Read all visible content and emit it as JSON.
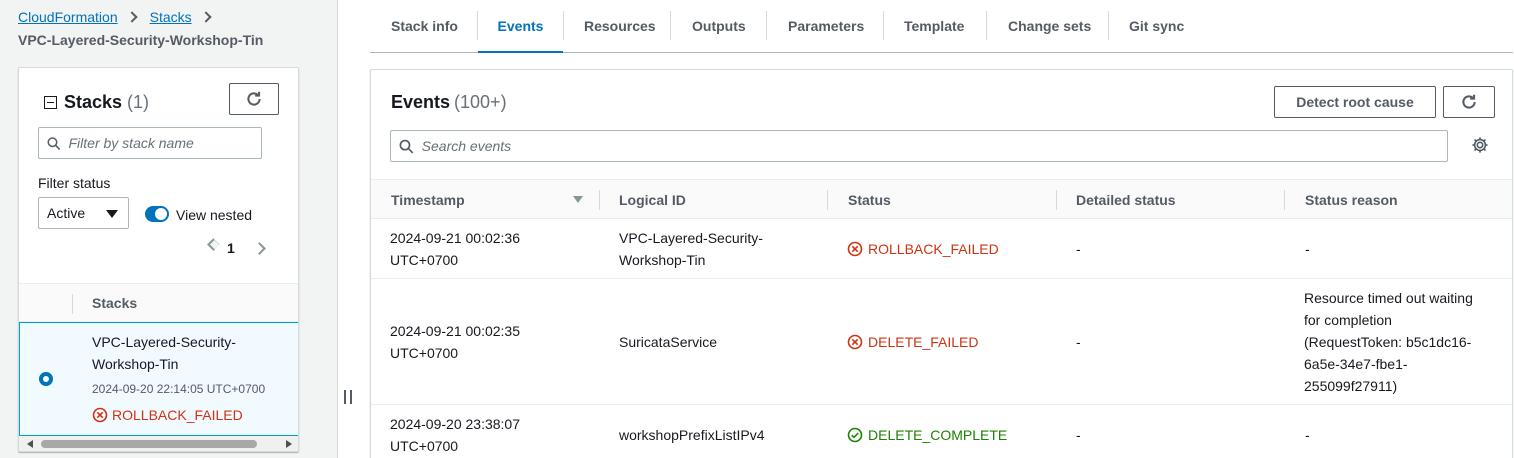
{
  "breadcrumb": {
    "root": "CloudFormation",
    "stacks": "Stacks",
    "current": "VPC-Layered-Security-Workshop-Tin"
  },
  "stacks_panel": {
    "title": "Stacks",
    "count": "(1)",
    "filter_placeholder": "Filter by stack name",
    "filter_status_label": "Filter status",
    "filter_status_value": "Active",
    "view_nested_label": "View nested",
    "view_nested_on": true,
    "page": "1",
    "column_header": "Stacks",
    "stacks": [
      {
        "name": "VPC-Layered-Security-Workshop-Tin",
        "created": "2024-09-20 22:14:05 UTC+0700",
        "status": "ROLLBACK_FAILED",
        "selected": true
      }
    ]
  },
  "tabs": [
    "Stack info",
    "Events",
    "Resources",
    "Outputs",
    "Parameters",
    "Template",
    "Change sets",
    "Git sync"
  ],
  "active_tab": "Events",
  "events": {
    "title": "Events",
    "count": "(100+)",
    "detect_button": "Detect root cause",
    "search_placeholder": "Search events",
    "columns": [
      "Timestamp",
      "Logical ID",
      "Status",
      "Detailed status",
      "Status reason"
    ],
    "rows": [
      {
        "timestamp": "2024-09-21 00:02:36 UTC+0700",
        "logical_id": "VPC-Layered-Security-Workshop-Tin",
        "status": "ROLLBACK_FAILED",
        "status_kind": "error",
        "detailed": "-",
        "reason": "-"
      },
      {
        "timestamp": "2024-09-21 00:02:35 UTC+0700",
        "logical_id": "SuricataService",
        "status": "DELETE_FAILED",
        "status_kind": "error",
        "detailed": "-",
        "reason": "Resource timed out waiting for completion (RequestToken: b5c1dc16-6a5e-34e7-fbe1-255099f27911)"
      },
      {
        "timestamp": "2024-09-20 23:38:07 UTC+0700",
        "logical_id": "workshopPrefixListIPv4",
        "status": "DELETE_COMPLETE",
        "status_kind": "success",
        "detailed": "-",
        "reason": "-"
      }
    ]
  },
  "colors": {
    "link": "#0073bb",
    "error": "#d13212",
    "success": "#1d8102",
    "selected_row": "#f1faff"
  }
}
